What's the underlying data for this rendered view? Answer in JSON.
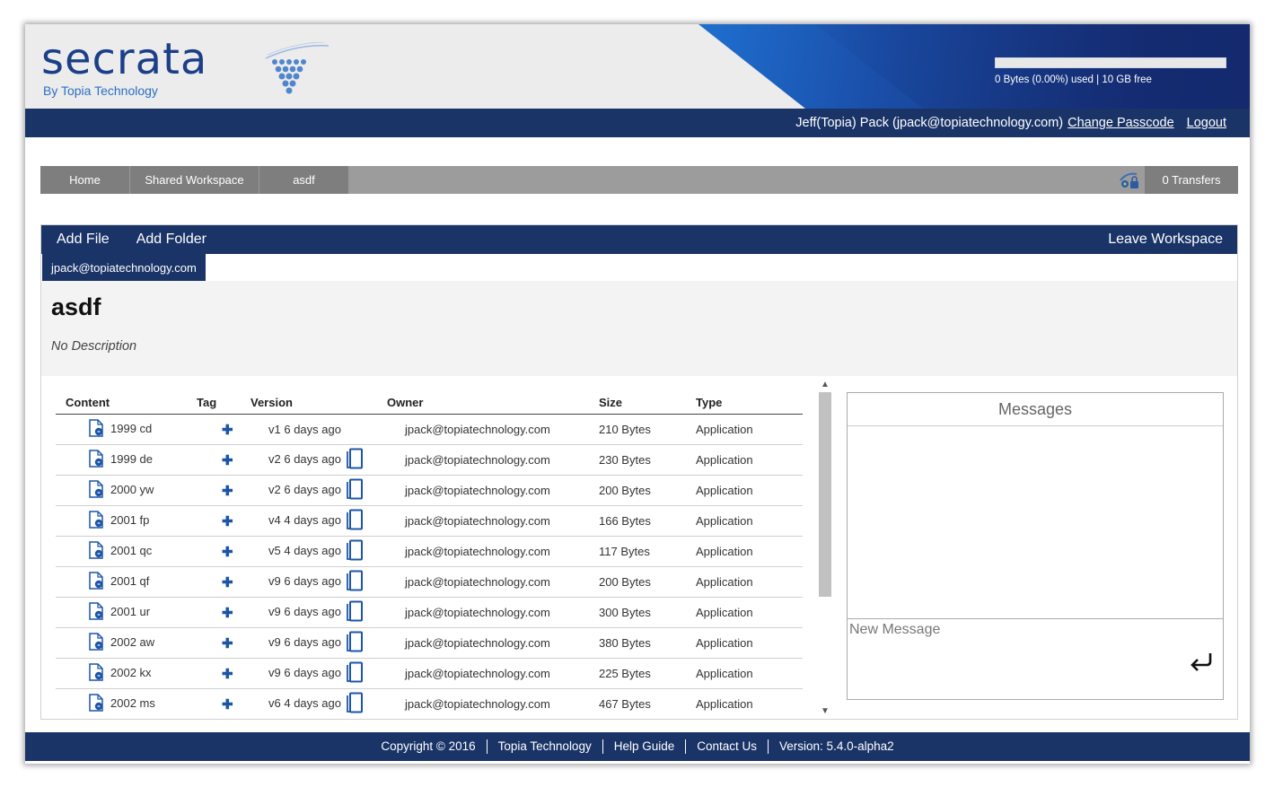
{
  "header": {
    "logo_text": "secrata",
    "logo_sub": "By Topia Technology",
    "storage_fraction": 0.0,
    "storage_text": "0 Bytes (0.00%) used | 10 GB free"
  },
  "userbar": {
    "user": "Jeff(Topia) Pack (jpack@topiatechnology.com)",
    "change_passcode": "Change Passcode",
    "logout": "Logout"
  },
  "breadcrumb": {
    "items": [
      "Home",
      "Shared Workspace",
      "asdf"
    ],
    "transfers": "0 Transfers"
  },
  "toolbar": {
    "add_file": "Add File",
    "add_folder": "Add Folder",
    "leave": "Leave Workspace"
  },
  "workspace": {
    "member": "jpack@topiatechnology.com",
    "title": "asdf",
    "description": "No Description"
  },
  "table": {
    "headers": [
      "Content",
      "Tag",
      "Version",
      "Owner",
      "Size",
      "Type"
    ],
    "rows": [
      {
        "name": "1999 cd",
        "ver": "v1",
        "when": "6 days ago",
        "owner": "jpack@topiatechnology.com",
        "size": "210 Bytes",
        "type": "Application",
        "icon": "file-icon",
        "history": false
      },
      {
        "name": "1999 de",
        "ver": "v2",
        "when": "6 days ago",
        "owner": "jpack@topiatechnology.com",
        "size": "230 Bytes",
        "type": "Application",
        "icon": "file-icon",
        "history": true
      },
      {
        "name": "2000 yw",
        "ver": "v2",
        "when": "6 days ago",
        "owner": "jpack@topiatechnology.com",
        "size": "200 Bytes",
        "type": "Application",
        "icon": "file-icon",
        "history": true
      },
      {
        "name": "2001 fp",
        "ver": "v4",
        "when": "4 days ago",
        "owner": "jpack@topiatechnology.com",
        "size": "166 Bytes",
        "type": "Application",
        "icon": "file-icon",
        "history": true
      },
      {
        "name": "2001 qc",
        "ver": "v5",
        "when": "4 days ago",
        "owner": "jpack@topiatechnology.com",
        "size": "117 Bytes",
        "type": "Application",
        "icon": "file-icon",
        "history": true
      },
      {
        "name": "2001 qf",
        "ver": "v9",
        "when": "6 days ago",
        "owner": "jpack@topiatechnology.com",
        "size": "200 Bytes",
        "type": "Application",
        "icon": "file-icon",
        "history": true
      },
      {
        "name": "2001 ur",
        "ver": "v9",
        "when": "6 days ago",
        "owner": "jpack@topiatechnology.com",
        "size": "300 Bytes",
        "type": "Application",
        "icon": "file-icon",
        "history": true
      },
      {
        "name": "2002 aw",
        "ver": "v9",
        "when": "6 days ago",
        "owner": "jpack@topiatechnology.com",
        "size": "380 Bytes",
        "type": "Application",
        "icon": "file-icon",
        "history": true
      },
      {
        "name": "2002 kx",
        "ver": "v9",
        "when": "6 days ago",
        "owner": "jpack@topiatechnology.com",
        "size": "225 Bytes",
        "type": "Application",
        "icon": "file-icon",
        "history": true
      },
      {
        "name": "2002 ms",
        "ver": "v6",
        "when": "4 days ago",
        "owner": "jpack@topiatechnology.com",
        "size": "467 Bytes",
        "type": "Application",
        "icon": "file-icon",
        "history": true
      }
    ]
  },
  "messages": {
    "title": "Messages",
    "placeholder": "New Message"
  },
  "footer": {
    "copyright": "Copyright © 2016",
    "company": "Topia Technology",
    "help": "Help Guide",
    "contact": "Contact Us",
    "version": "Version: 5.4.0-alpha2"
  },
  "colors": {
    "navy": "#1a3468",
    "accent": "#1c55a8",
    "crumb": "#7e7e7e"
  }
}
